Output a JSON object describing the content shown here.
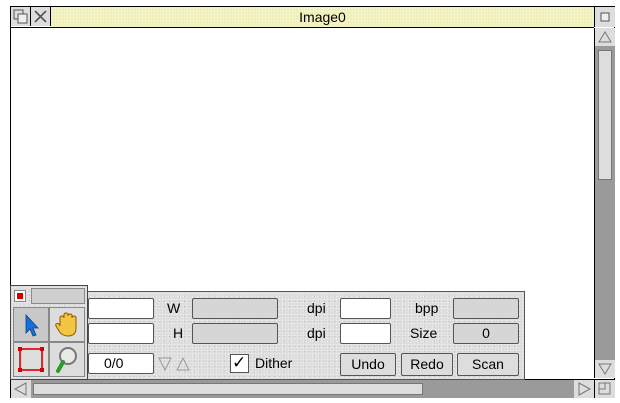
{
  "window": {
    "title": "Image0"
  },
  "toolbar": {
    "w_label": "W",
    "h_label": "H",
    "dpi_label_1": "dpi",
    "dpi_label_2": "dpi",
    "bpp_label": "bpp",
    "size_label": "Size",
    "size_value": "0",
    "page_value": "0/0",
    "dither_label": "Dither",
    "dither_checked": true,
    "undo_label": "Undo",
    "redo_label": "Redo",
    "scan_label": "Scan"
  },
  "tools": {
    "items": [
      {
        "name": "select-arrow-icon",
        "selected": true
      },
      {
        "name": "hand-icon",
        "selected": false
      },
      {
        "name": "rectangle-select-icon",
        "selected": false
      },
      {
        "name": "magnifier-icon",
        "selected": false
      }
    ]
  },
  "colors": {
    "title_bar": "#f0efb8",
    "stone": "#dddddd",
    "scroll_well": "#9a9a9a",
    "arrow_tool": "#1a6fd6",
    "rect_tool": "#d40000",
    "magnifier_handle": "#2a9a2a"
  }
}
